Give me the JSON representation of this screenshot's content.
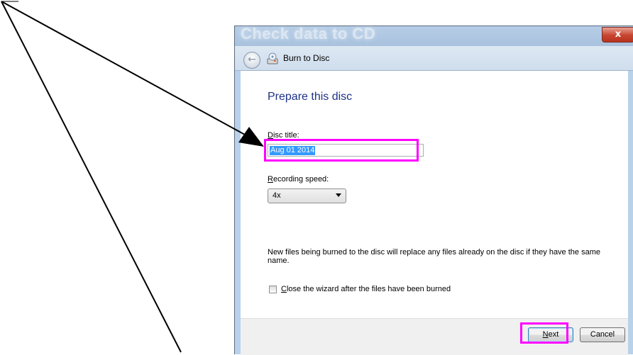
{
  "window": {
    "title": "Check data to CD",
    "close_glyph": "x"
  },
  "nav": {
    "back_glyph": "←",
    "title": "Burn to Disc",
    "icon": "burn-disc-icon"
  },
  "main": {
    "heading": "Prepare this disc",
    "disc_title_label_key": "D",
    "disc_title_label_rest": "isc title:",
    "disc_title_value": "Aug 01 2014",
    "recording_speed_label_key": "R",
    "recording_speed_label_rest": "ecording speed:",
    "recording_speed_value": "4x",
    "info_text": "New files being burned to the disc will replace any files already on the disc if they have the same name.",
    "close_checkbox_label_key": "C",
    "close_checkbox_label_rest": "lose the wizard after the files have been burned",
    "close_checkbox_checked": false
  },
  "footer": {
    "next_label_key": "N",
    "next_label_rest": "ext",
    "cancel_label": "Cancel"
  },
  "annotations": {
    "highlight_color": "#ff00ff",
    "arrow_color": "#000000"
  }
}
